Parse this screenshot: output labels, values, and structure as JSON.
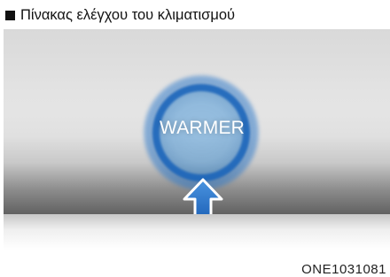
{
  "header": {
    "title": "Πίνακας ελέγχου του κλιματισμού"
  },
  "panel": {
    "button_label": "WARMER",
    "accent_color": "#2a72c7",
    "arrow_icon": "up-arrow-icon"
  },
  "figure": {
    "code": "ONE1031081"
  }
}
